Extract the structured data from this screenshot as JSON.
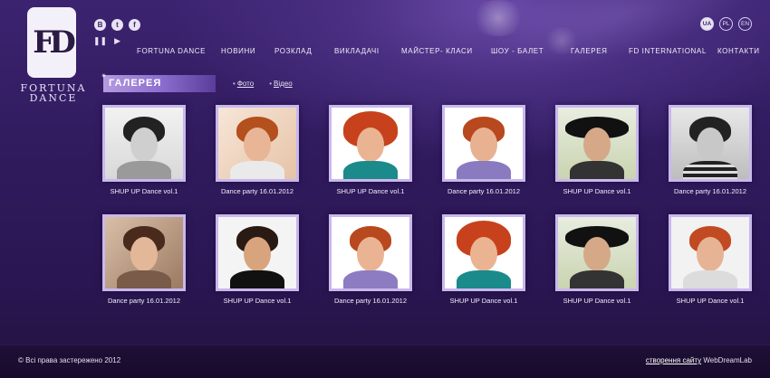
{
  "logo": {
    "mark": "FD",
    "line1": "FORTUNA",
    "line2": "DANCE"
  },
  "social": [
    {
      "icon": "vk-icon",
      "glyph": "B"
    },
    {
      "icon": "twitter-icon",
      "glyph": "t"
    },
    {
      "icon": "facebook-icon",
      "glyph": "f"
    }
  ],
  "player": {
    "pause": "❚❚",
    "play": "▶"
  },
  "languages": [
    {
      "code": "UA",
      "active": true
    },
    {
      "code": "PL",
      "active": false
    },
    {
      "code": "EN",
      "active": false
    }
  ],
  "nav": [
    "FORTUNA DANCE",
    "НОВИНИ",
    "РОЗКЛАД",
    "ВИКЛАДАЧІ",
    "МАЙСТЕР- КЛАСИ",
    "ШОУ - БАЛЕТ",
    "ГАЛЕРЕЯ",
    "FD INTERNATIONAL",
    "КОНТАКТИ"
  ],
  "gallery": {
    "title": "ГАЛЕРЕЯ",
    "links": [
      "Фото",
      "Відео"
    ],
    "items": [
      {
        "caption": "SHUP UP Dance vol.1"
      },
      {
        "caption": "Dance party 16.01.2012"
      },
      {
        "caption": "SHUP UP Dance vol.1"
      },
      {
        "caption": "Dance party 16.01.2012"
      },
      {
        "caption": "SHUP UP Dance vol.1"
      },
      {
        "caption": "Dance party 16.01.2012"
      },
      {
        "caption": "Dance party 16.01.2012"
      },
      {
        "caption": "SHUP UP Dance vol.1"
      },
      {
        "caption": "Dance party 16.01.2012"
      },
      {
        "caption": "SHUP UP Dance vol.1"
      },
      {
        "caption": "SHUP UP Dance vol.1"
      },
      {
        "caption": "SHUP UP Dance vol.1"
      }
    ]
  },
  "footer": {
    "copyright": "© Всі права застережено 2012",
    "dev_link": "створення сайту",
    "dev_name": "WebDreamLab"
  }
}
